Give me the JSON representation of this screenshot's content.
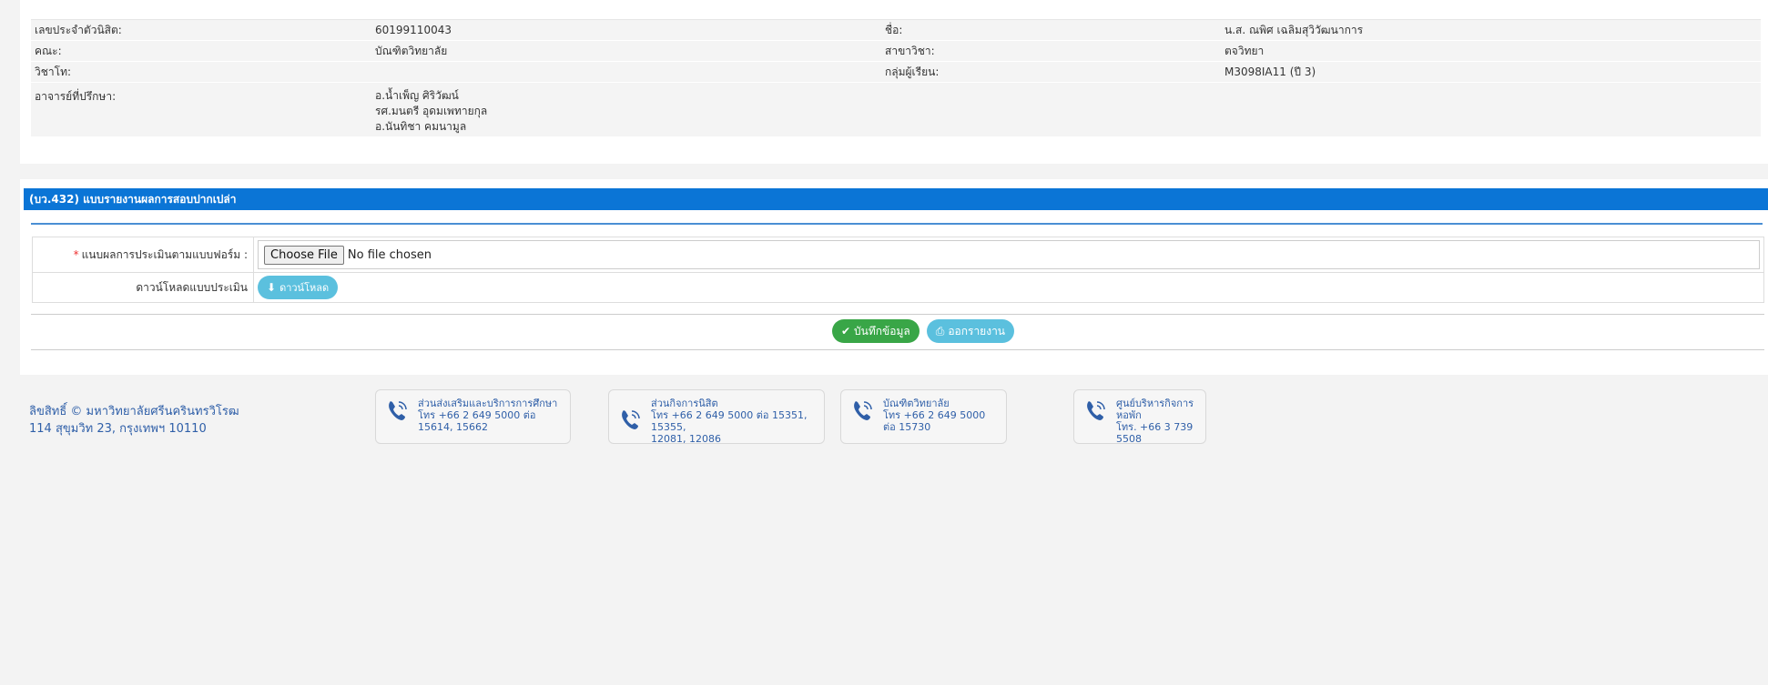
{
  "student_info": {
    "rows": [
      {
        "label1": "เลขประจำตัวนิสิต:",
        "value1": "60199110043",
        "label2": "ชื่อ:",
        "value2": "น.ส. ณพิศ เฉลิมสุวิวัฒนาการ"
      },
      {
        "label1": "คณะ:",
        "value1": "บัณฑิตวิทยาลัย",
        "label2": "สาขาวิชา:",
        "value2": "ตจวิทยา"
      },
      {
        "label1": "วิชาโท:",
        "value1": "",
        "label2": "กลุ่มผู้เรียน:",
        "value2": "M3098IA11 (ปี 3)"
      }
    ],
    "advisor_label": "อาจารย์ที่ปรึกษา:",
    "advisors": [
      "อ.น้ำเพ็ญ ศิริวัฒน์",
      "รศ.มนตรี อุดมเพทายกุล",
      "อ.นันทิชา คมนามูล"
    ]
  },
  "form": {
    "title": "(บว.432) แบบรายงานผลการสอบปากเปล่า",
    "upload_label": "แนบผลการประเมินตามแบบฟอร์ม :",
    "required_mark": "*",
    "choose_file_label": "Choose File",
    "no_file_text": "No file chosen",
    "download_label": "ดาวน์โหลดแบบประเมิน",
    "download_button": "ดาวน์โหลด",
    "save_button": "บันทึกข้อมูล",
    "report_button": "ออกรายงาน"
  },
  "footer": {
    "copyright_line1": "ลิขสิทธิ์ © มหาวิทยาลัยศรีนครินทรวิโรฒ",
    "copyright_line2": "114 สุขุมวิท 23, กรุงเทพฯ 10110",
    "contacts": [
      {
        "name": "ส่วนส่งเสริมและบริการการศึกษา",
        "phone": "โทร +66 2 649 5000 ต่อ 15614, 15662"
      },
      {
        "name": "ส่วนกิจการนิสิต",
        "phone": "โทร +66 2 649 5000 ต่อ 15351, 15355,",
        "phone2": "12081, 12086"
      },
      {
        "name": "บัณฑิตวิทยาลัย",
        "phone": "โทร +66 2 649 5000 ต่อ 15730"
      },
      {
        "name": "ศูนย์บริหารกิจการหอพัก",
        "phone": "โทร. +66 3 739 5508"
      }
    ]
  },
  "colors": {
    "header_blue": "#0b75d6",
    "save_green": "#39a647",
    "cyan": "#5bc0de",
    "link_blue": "#2f5fa8"
  }
}
